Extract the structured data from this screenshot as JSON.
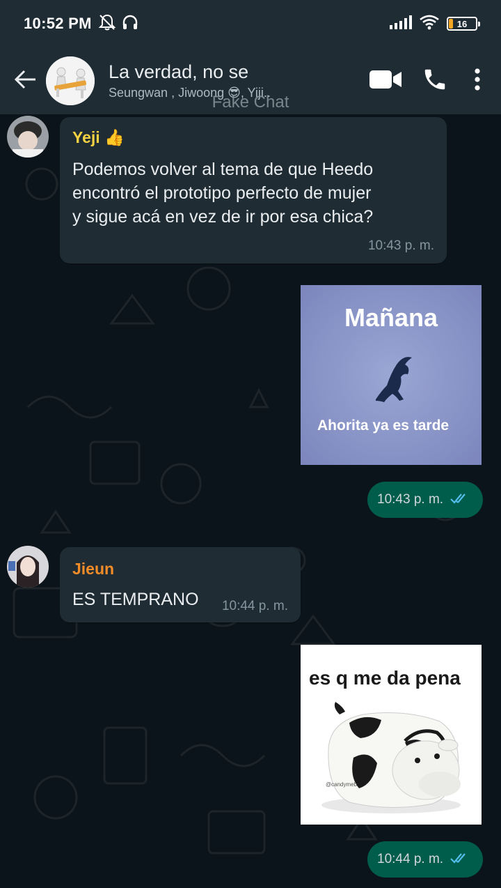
{
  "status_bar": {
    "time": "10:52 PM",
    "battery": "16",
    "battery_level_percent": 16,
    "icons": [
      "muted-bell-icon",
      "headphones-icon",
      "signal-icon",
      "wifi-icon",
      "battery-icon"
    ]
  },
  "header": {
    "title": "La verdad, no se",
    "subtitle": "Seungwan , Jiwoong 😎, Yiji..",
    "watermark": "Fake Chat",
    "actions": [
      "video-call-icon",
      "voice-call-icon",
      "more-options-icon"
    ]
  },
  "messages": [
    {
      "type": "incoming_text",
      "sender": "Yeji 👍",
      "sender_color": "#f5d242",
      "text_lines": [
        "Podemos volver al tema de que Heedo",
        "encontró el prototipo perfecto de mujer",
        "y sigue acá en vez de ir por esa chica?"
      ],
      "time": "10:43 p. m."
    },
    {
      "type": "outgoing_image",
      "caption_top": "Mañana",
      "caption_bottom": "Ahorita ya es tarde",
      "time": "10:43 p. m.",
      "read_color": "#53bdeb"
    },
    {
      "type": "incoming_text",
      "sender": "Jieun",
      "sender_color": "#f28c28",
      "text": "ES TEMPRANO",
      "time": "10:44 p. m."
    },
    {
      "type": "outgoing_image",
      "caption_top": "es q me da pena",
      "watermark_text": "@candymeb",
      "time": "10:44 p. m.",
      "read_color": "#53bdeb"
    }
  ],
  "colors": {
    "header_bg": "#1f2c34",
    "chat_bg": "#0b141a",
    "incoming_bubble": "#1f2c34",
    "outgoing_bubble": "#005c4b"
  }
}
